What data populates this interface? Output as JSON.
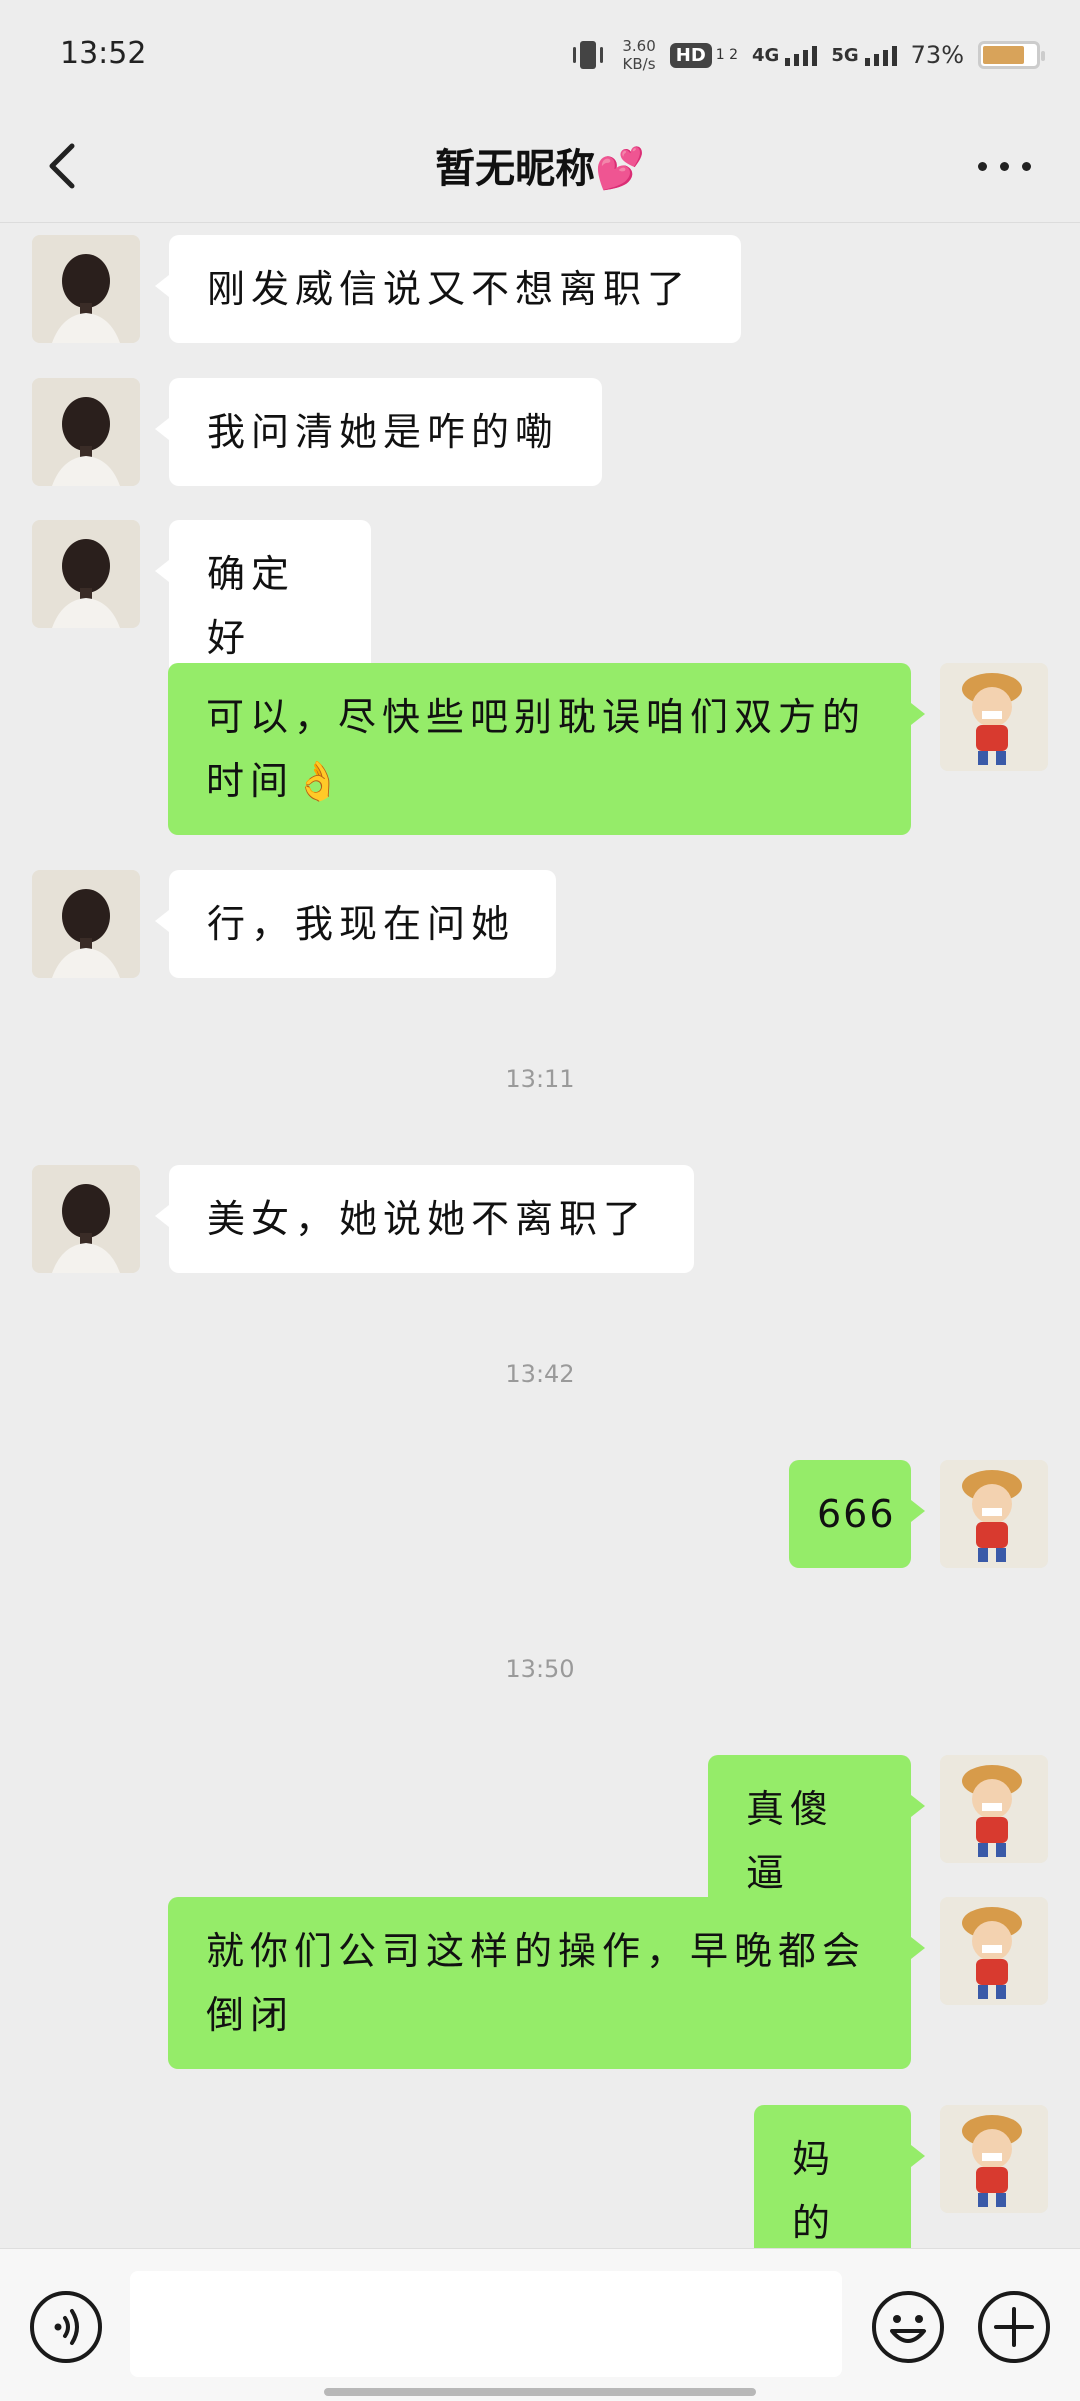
{
  "status_bar": {
    "time": "13:52",
    "net_speed_value": "3.60",
    "net_speed_unit": "KB/s",
    "hd_label": "HD",
    "hd_sub": "1 2",
    "signal1_label": "4G",
    "signal2_label": "5G",
    "battery_percent": "73%",
    "battery_level": 0.73
  },
  "header": {
    "title": "暂无昵称",
    "title_emoji": "💕"
  },
  "messages": [
    {
      "side": "other",
      "text": "刚发威信说又不想离职了"
    },
    {
      "side": "other",
      "text": "我问清她是咋的嘞"
    },
    {
      "side": "other",
      "text": "确定好"
    },
    {
      "side": "self",
      "text": "可以，尽快些吧别耽误咱们双方的时间👌"
    },
    {
      "side": "other",
      "text": "行，我现在问她"
    },
    {
      "side": "other",
      "text": "美女，她说她不离职了"
    },
    {
      "side": "self",
      "text": "666"
    },
    {
      "side": "self",
      "text": "真傻逼"
    },
    {
      "side": "self",
      "text": "就你们公司这样的操作，早晚都会倒闭"
    },
    {
      "side": "self",
      "text": "妈的"
    }
  ],
  "timestamps": [
    "13:11",
    "13:42",
    "13:50"
  ],
  "input": {
    "value": "",
    "placeholder": ""
  },
  "icons": {
    "back": "chevron-left-icon",
    "more": "more-dots-icon",
    "voice": "voice-icon",
    "emoji": "emoji-icon",
    "plus": "plus-icon"
  },
  "colors": {
    "background": "#ededed",
    "self_bubble": "#95ec69",
    "other_bubble": "#ffffff",
    "accent_heart": "#ff3d9a"
  }
}
